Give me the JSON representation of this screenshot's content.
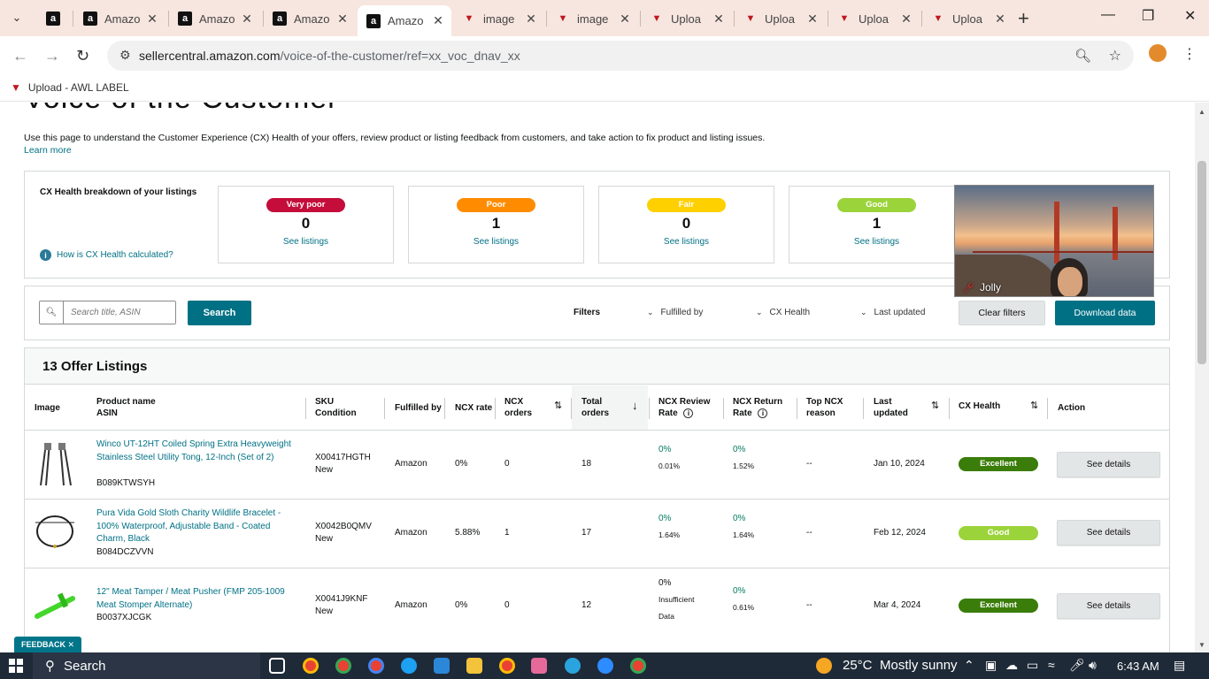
{
  "browser": {
    "tabs": [
      {
        "label": "",
        "icon": "amazon-icon",
        "active": false
      },
      {
        "label": "Amazo",
        "icon": "amazon-icon",
        "active": false
      },
      {
        "label": "Amazo",
        "icon": "amazon-icon",
        "active": false
      },
      {
        "label": "Amazo",
        "icon": "amazon-icon",
        "active": false
      },
      {
        "label": "Amazo",
        "icon": "amazon-icon",
        "active": true
      },
      {
        "label": "image",
        "icon": "awl-icon",
        "active": false
      },
      {
        "label": "image",
        "icon": "awl-icon",
        "active": false
      },
      {
        "label": "Uploa",
        "icon": "awl-icon",
        "active": false
      },
      {
        "label": "Uploa",
        "icon": "awl-icon",
        "active": false
      },
      {
        "label": "Uploa",
        "icon": "awl-icon",
        "active": false
      },
      {
        "label": "Uploa",
        "icon": "awl-icon",
        "active": false
      }
    ],
    "url_host": "sellercentral.amazon.com",
    "url_path": "/voice-of-the-customer/ref=xx_voc_dnav_xx",
    "bookmark": "Upload - AWL LABEL"
  },
  "page": {
    "title": "Voice of the Customer",
    "intro": "Use this page to understand the Customer Experience (CX) Health of your offers, review product or listing feedback from customers, and take action to fix product and listing issues.",
    "learn_more": "Learn more",
    "cx_title": "CX Health breakdown of your listings",
    "cx_how": "How is CX Health calculated?",
    "cards": [
      {
        "label": "Very poor",
        "count": "0",
        "link": "See listings",
        "color": "#c40d3a",
        "text_color": "#ffffff"
      },
      {
        "label": "Poor",
        "count": "1",
        "link": "See listings",
        "color": "#ff8c00",
        "text_color": "#ffffff"
      },
      {
        "label": "Fair",
        "count": "0",
        "link": "See listings",
        "color": "#ffd000",
        "text_color": "#ffffff"
      },
      {
        "label": "Good",
        "count": "1",
        "link": "See listings",
        "color": "#9bd33a",
        "text_color": "#ffffff"
      }
    ],
    "video_name": "Jolly",
    "search_placeholder": "Search title, ASIN",
    "search_btn": "Search",
    "filters_label": "Filters",
    "filter_fulfilled": "Fulfilled by",
    "filter_cx": "CX Health",
    "filter_updated": "Last updated",
    "clear_filters": "Clear filters",
    "download": "Download data",
    "listing_title": "13 Offer Listings",
    "columns": {
      "image": "Image",
      "product_name": "Product name",
      "asin": "ASIN",
      "sku": "SKU",
      "condition": "Condition",
      "fulfilled": "Fulfilled by",
      "ncx_rate": "NCX rate",
      "ncx_orders_1": "NCX",
      "ncx_orders_2": "orders",
      "total_orders_1": "Total",
      "total_orders_2": "orders",
      "review_rate_1": "NCX Review",
      "review_rate_2": "Rate",
      "return_rate_1": "NCX Return",
      "return_rate_2": "Rate",
      "top_reason_1": "Top NCX",
      "top_reason_2": "reason",
      "last_updated_1": "Last",
      "last_updated_2": "updated",
      "cx_health": "CX Health",
      "action": "Action"
    },
    "rows": [
      {
        "name": "Winco UT-12HT Coiled Spring Extra Heavyweight Stainless Steel Utility Tong, 12-Inch (Set of 2)",
        "asin": "B089KTWSYH",
        "sku": "X00417HGTH",
        "condition": "New",
        "fulfilled": "Amazon",
        "ncx_rate": "0%",
        "ncx_orders": "0",
        "total_orders": "18",
        "review_rate": "0%",
        "review_sub": "0.01%",
        "return_rate": "0%",
        "return_sub": "1.52%",
        "top_reason": "--",
        "last_updated": "Jan 10, 2024",
        "cx": "Excellent",
        "cx_color": "#3a7d0a",
        "action": "See details"
      },
      {
        "name": "Pura Vida Gold Sloth Charity Wildlife Bracelet - 100% Waterproof, Adjustable Band - Coated Charm, Black",
        "asin": "B084DCZVVN",
        "sku": "X0042B0QMV",
        "condition": "New",
        "fulfilled": "Amazon",
        "ncx_rate": "5.88%",
        "ncx_orders": "1",
        "total_orders": "17",
        "review_rate": "0%",
        "review_sub": "1.64%",
        "return_rate": "0%",
        "return_sub": "1.64%",
        "top_reason": "--",
        "last_updated": "Feb 12, 2024",
        "cx": "Good",
        "cx_color": "#9bd33a",
        "action": "See details"
      },
      {
        "name": "12\" Meat Tamper / Meat Pusher (FMP 205-1009 Meat Stomper Alternate)",
        "asin": "B0037XJCGK",
        "sku": "X0041J9KNF",
        "condition": "New",
        "fulfilled": "Amazon",
        "ncx_rate": "0%",
        "ncx_orders": "0",
        "total_orders": "12",
        "review_rate": "0%",
        "review_sub": "Insufficient Data",
        "return_rate": "0%",
        "return_sub": "0.61%",
        "top_reason": "--",
        "last_updated": "Mar 4, 2024",
        "cx": "Excellent",
        "cx_color": "#3a7d0a",
        "action": "See details"
      }
    ],
    "feedback": "FEEDBACK"
  },
  "taskbar": {
    "search": "Search",
    "weather_temp": "25°C",
    "weather_text": "Mostly sunny",
    "time": "6:43 AM"
  }
}
